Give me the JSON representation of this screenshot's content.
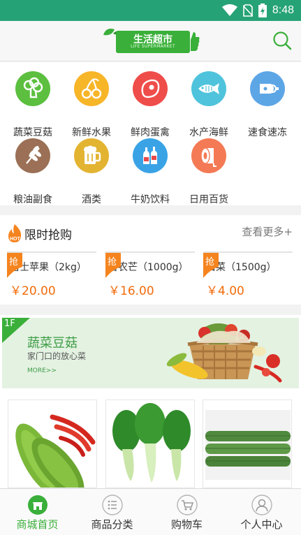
{
  "status_bar": {
    "time": "8:48",
    "icons": [
      "wifi-icon",
      "no-sim-icon",
      "battery-charging-icon"
    ]
  },
  "header": {
    "logo_title": "生活超市",
    "logo_subtitle": "LIFE SUPERMARKET",
    "search_icon": "search-icon"
  },
  "categories": [
    {
      "label": "蔬菜豆菇",
      "icon": "broccoli-icon",
      "color": "#5cbf3f"
    },
    {
      "label": "新鲜水果",
      "icon": "cherry-icon",
      "color": "#f7b528"
    },
    {
      "label": "鲜肉蛋禽",
      "icon": "meat-icon",
      "color": "#ef4d4a"
    },
    {
      "label": "水产海鲜",
      "icon": "fish-icon",
      "color": "#4fc3dc"
    },
    {
      "label": "速食速冻",
      "icon": "ham-icon",
      "color": "#5da6e6"
    },
    {
      "label": "粮油副食",
      "icon": "wheat-icon",
      "color": "#9b7056"
    },
    {
      "label": "酒类",
      "icon": "beer-icon",
      "color": "#e3b432"
    },
    {
      "label": "牛奶饮料",
      "icon": "bottles-icon",
      "color": "#3aa3e6"
    },
    {
      "label": "日用百货",
      "icon": "tissue-roll-icon",
      "color": "#f47a55"
    }
  ],
  "flash_sale": {
    "title": "限时抢购",
    "more": "查看更多+",
    "tag": "抢",
    "items": [
      {
        "name": "富士苹果（2kg）",
        "price": "￥20.00"
      },
      {
        "name": "台农芒（1000g）",
        "price": "￥16.00"
      },
      {
        "name": "白菜（1500g）",
        "price": "￥4.00"
      }
    ]
  },
  "floor": {
    "badge": "1F",
    "title": "蔬菜豆菇",
    "subtitle": "家门口的放心菜",
    "more": "MORE>>"
  },
  "tabs": [
    {
      "label": "商城首页",
      "icon": "store-icon",
      "active": true
    },
    {
      "label": "商品分类",
      "icon": "list-icon",
      "active": false
    },
    {
      "label": "购物车",
      "icon": "cart-icon",
      "active": false
    },
    {
      "label": "个人中心",
      "icon": "user-icon",
      "active": false
    }
  ],
  "colors": {
    "primary": "#26a376",
    "accent": "#3aaf3a",
    "price": "#f26b0a"
  }
}
